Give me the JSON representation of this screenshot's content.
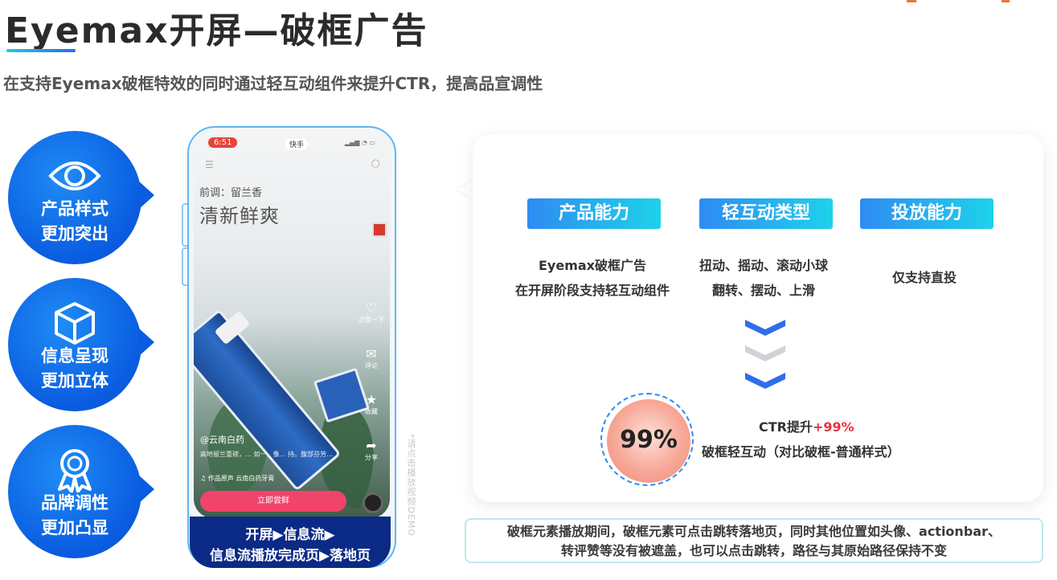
{
  "header": {
    "title": "Eyemax开屏—破框广告",
    "subtitle": "在支持Eyemax破框特效的同时通过轻互动组件来提升CTR，提高品宣调性"
  },
  "features": [
    {
      "icon": "eye-icon",
      "line1": "产品样式",
      "line2": "更加突出"
    },
    {
      "icon": "cube-icon",
      "line1": "信息呈现",
      "line2": "更加立体"
    },
    {
      "icon": "ribbon-award-icon",
      "line1": "品牌调性",
      "line2": "更加凸显"
    }
  ],
  "phone": {
    "time": "6:51",
    "app_name": "快手",
    "ad_small": "前调：留兰香",
    "ad_big": "清新鲜爽",
    "account": "@云南白药",
    "desc": "高地留兰重磅，… 如一，像… 持。腹部芬芳…",
    "music": "♫ 作品原声  云南白药牙膏",
    "side_actions": [
      "点赞一下",
      "评论",
      "收藏",
      "分享"
    ],
    "cta": "立即尝鲜",
    "banner_line1_parts": [
      "开屏",
      "信息流"
    ],
    "banner_line2_parts": [
      "信息流播放完成页",
      "落地页"
    ],
    "demo_note": "*请点击播放视频DEMO"
  },
  "panel": {
    "columns": [
      {
        "tag": "产品能力",
        "lines": [
          "Eyemax破框广告",
          "在开屏阶段支持轻互动组件"
        ]
      },
      {
        "tag": "轻互动类型",
        "lines": [
          "扭动、摇动、滚动小球",
          "翻转、摆动、上滑"
        ]
      },
      {
        "tag": "投放能力",
        "lines": [
          "仅支持直投"
        ]
      }
    ],
    "score": "99%",
    "ctr_label": "CTR提升",
    "ctr_value": "+99%",
    "compare": "破框轻互动（对比破框-普通样式）"
  },
  "note": {
    "line1": "破框元素播放期间，破框元素可点击跳转落地页，同时其他位置如头像、actionbar、",
    "line2": "转评赞等没有被遮盖，也可以点击跳转，路径与其原始路径保持不变"
  },
  "colors": {
    "accent_blue": "#0a5ce0",
    "tag_gradient_start": "#2f8bf2",
    "tag_gradient_end": "#1ed2ea",
    "highlight_red": "#e8313a",
    "banner_navy": "#0b2a86"
  }
}
